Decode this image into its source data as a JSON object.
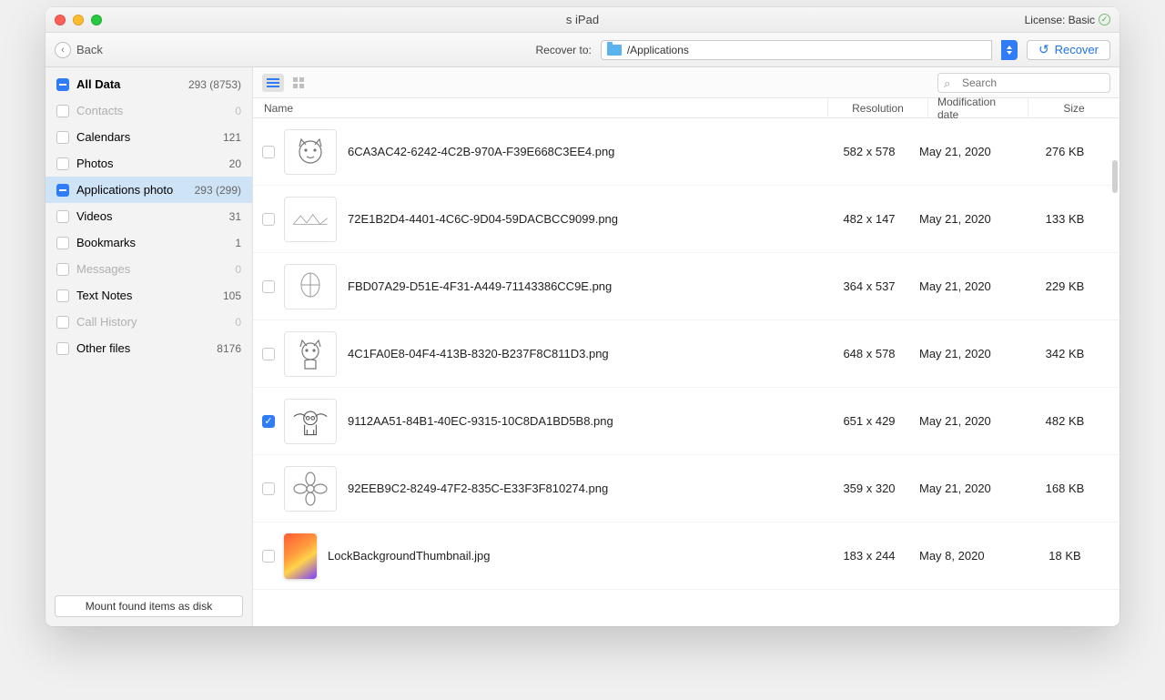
{
  "window": {
    "title": "s iPad"
  },
  "license": {
    "label": "License: Basic"
  },
  "toolbar": {
    "back": "Back",
    "recover_to_label": "Recover to:",
    "path": "/Applications",
    "recover_button": "Recover"
  },
  "sidebar": {
    "items": [
      {
        "label": "All Data",
        "count": "293 (8753)",
        "check": "indeterminate",
        "bold": true
      },
      {
        "label": "Contacts",
        "count": "0",
        "disabled": true
      },
      {
        "label": "Calendars",
        "count": "121"
      },
      {
        "label": "Photos",
        "count": "20"
      },
      {
        "label": "Applications photo",
        "count": "293 (299)",
        "selected": true,
        "check": "indeterminate"
      },
      {
        "label": "Videos",
        "count": "31"
      },
      {
        "label": "Bookmarks",
        "count": "1"
      },
      {
        "label": "Messages",
        "count": "0",
        "disabled": true
      },
      {
        "label": "Text Notes",
        "count": "105"
      },
      {
        "label": "Call History",
        "count": "0",
        "disabled": true
      },
      {
        "label": "Other files",
        "count": "8176"
      }
    ],
    "mount_button": "Mount found items as disk"
  },
  "columns": {
    "name": "Name",
    "resolution": "Resolution",
    "modified": "Modification date",
    "size": "Size"
  },
  "search": {
    "placeholder": "Search"
  },
  "files": [
    {
      "name": "6CA3AC42-6242-4C2B-970A-F39E668C3EE4.png",
      "resolution": "582 x 578",
      "modified": "May 21, 2020",
      "size": "276 KB",
      "thumb": "cat1"
    },
    {
      "name": "72E1B2D4-4401-4C6C-9D04-59DACBCC9099.png",
      "resolution": "482 x 147",
      "modified": "May 21, 2020",
      "size": "133 KB",
      "thumb": "mountains"
    },
    {
      "name": "FBD07A29-D51E-4F31-A449-71143386CC9E.png",
      "resolution": "364 x 537",
      "modified": "May 21, 2020",
      "size": "229 KB",
      "thumb": "head"
    },
    {
      "name": "4C1FA0E8-04F4-413B-8320-B237F8C811D3.png",
      "resolution": "648 x 578",
      "modified": "May 21, 2020",
      "size": "342 KB",
      "thumb": "cat2"
    },
    {
      "name": "9112AA51-84B1-40EC-9315-10C8DA1BD5B8.png",
      "resolution": "651 x 429",
      "modified": "May 21, 2020",
      "size": "482 KB",
      "thumb": "yoda",
      "checked": true
    },
    {
      "name": "92EEB9C2-8249-47F2-835C-E33F3F810274.png",
      "resolution": "359 x 320",
      "modified": "May 21, 2020",
      "size": "168 KB",
      "thumb": "flower"
    },
    {
      "name": "LockBackgroundThumbnail.jpg",
      "resolution": "183 x 244",
      "modified": "May 8, 2020",
      "size": "18 KB",
      "thumb": "gradient"
    }
  ]
}
